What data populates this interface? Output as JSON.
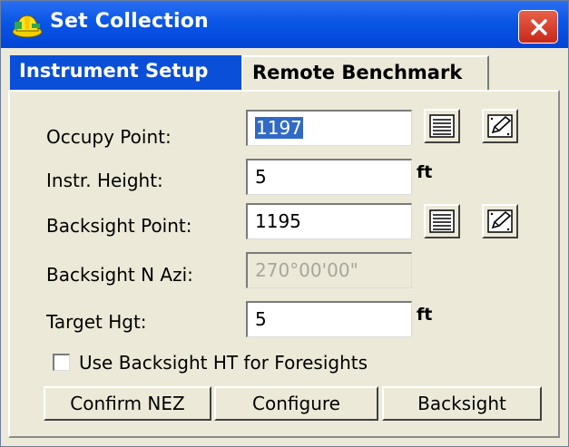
{
  "window": {
    "title": "Set Collection"
  },
  "tabs": [
    {
      "label": "Instrument Setup",
      "active": true
    },
    {
      "label": "Remote Benchmark",
      "active": false
    }
  ],
  "form": {
    "occupy_point": {
      "label": "Occupy Point:",
      "value": "1197"
    },
    "instr_height": {
      "label": "Instr. Height:",
      "value": "5",
      "unit": "ft"
    },
    "backsight_point": {
      "label": "Backsight Point:",
      "value": "1195"
    },
    "backsight_azi": {
      "label": "Backsight N Azi:",
      "value": "270°00'00\"",
      "disabled": true
    },
    "target_hgt": {
      "label": "Target Hgt:",
      "value": "5",
      "unit": "ft"
    },
    "use_backsight_ht": {
      "label": "Use Backsight HT for Foresights",
      "checked": false
    }
  },
  "buttons": {
    "confirm_nez": "Confirm NEZ",
    "configure": "Configure",
    "backsight": "Backsight"
  },
  "icons": {
    "list": "list-icon",
    "edit": "edit-point-icon",
    "close": "close-icon",
    "app": "hard-hat-icon"
  },
  "colors": {
    "titlebar": "#0a56e6",
    "active_tab": "#0a4fd8",
    "close": "#d5402b",
    "selection": "#3169c6"
  }
}
